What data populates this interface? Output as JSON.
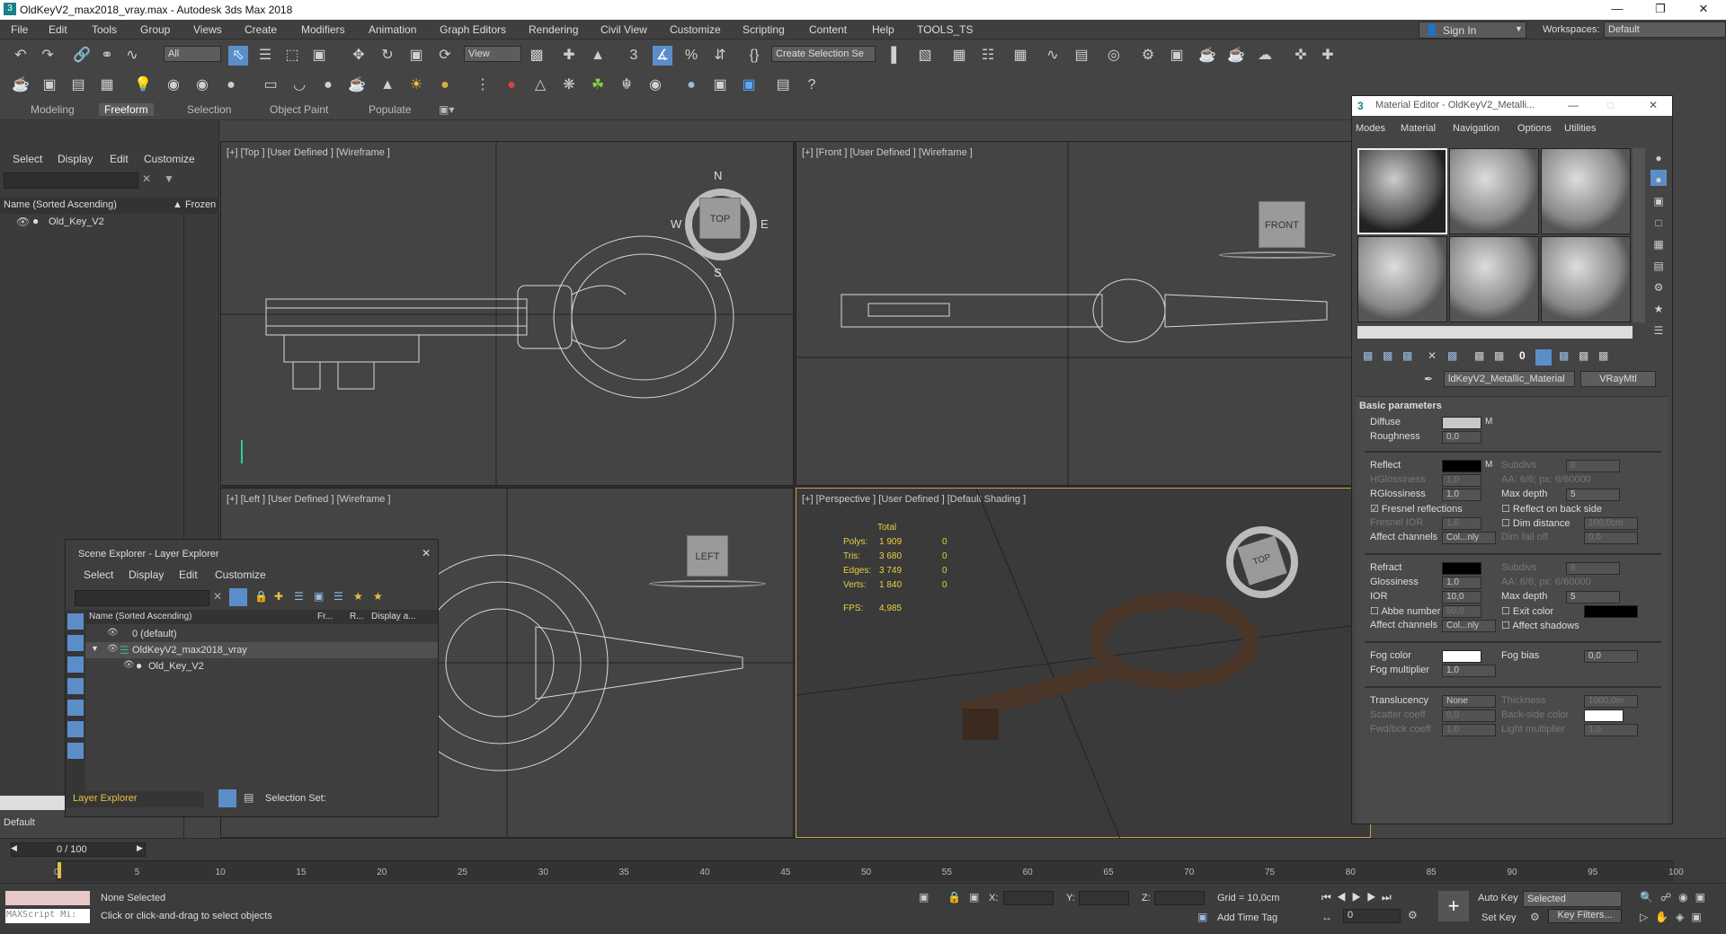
{
  "window": {
    "title": "OldKeyV2_max2018_vray.max - Autodesk 3ds Max 2018"
  },
  "menu": [
    "File",
    "Edit",
    "Tools",
    "Group",
    "Views",
    "Create",
    "Modifiers",
    "Animation",
    "Graph Editors",
    "Rendering",
    "Civil View",
    "Customize",
    "Scripting",
    "Content",
    "Help",
    "TOOLS_TS"
  ],
  "signin": "Sign In",
  "workspaces": {
    "label": "Workspaces:",
    "value": "Default"
  },
  "toolbar": {
    "filter": "All",
    "view": "View",
    "selection_set": "Create Selection Se"
  },
  "ribbon_tabs": [
    "Modeling",
    "Freeform",
    "Selection",
    "Object Paint",
    "Populate"
  ],
  "left_panel": {
    "tabs": [
      "Select",
      "Display",
      "Edit",
      "Customize"
    ],
    "header_name": "Name (Sorted Ascending)",
    "header_frozen": "▲ Frozen",
    "items": [
      "Old_Key_V2"
    ],
    "footer": "Default"
  },
  "viewports": {
    "top": "[+] [Top ] [User Defined ] [Wireframe ]",
    "front": "[+] [Front ] [User Defined ] [Wireframe ]",
    "left": "[+] [Left ] [User Defined ] [Wireframe ]",
    "persp": "[+] [Perspective ] [User Defined ] [Default Shading ]",
    "cube_top": "TOP",
    "cube_front": "FRONT",
    "cube_left": "LEFT",
    "compass": {
      "n": "N",
      "s": "S",
      "e": "E",
      "w": "W"
    },
    "stats": {
      "total_label": "Total",
      "rows": [
        {
          "k": "Polys:",
          "v": "1 909",
          "s": "0"
        },
        {
          "k": "Tris:",
          "v": "3 680",
          "s": "0"
        },
        {
          "k": "Edges:",
          "v": "3 749",
          "s": "0"
        },
        {
          "k": "Verts:",
          "v": "1 840",
          "s": "0"
        }
      ],
      "fps_label": "FPS:",
      "fps": "4,985"
    }
  },
  "scene_explorer": {
    "title": "Scene Explorer - Layer Explorer",
    "menu": [
      "Select",
      "Display",
      "Edit",
      "Customize"
    ],
    "cols": [
      "Name (Sorted Ascending)",
      "Fr...",
      "R...",
      "Display a..."
    ],
    "rows": [
      "0 (default)",
      "OldKeyV2_max2018_vray",
      "Old_Key_V2"
    ],
    "footer_explorer": "Layer Explorer",
    "footer_sel": "Selection Set:"
  },
  "material_editor": {
    "title": "Material Editor - OldKeyV2_Metalli...",
    "menu": [
      "Modes",
      "Material",
      "Navigation",
      "Options",
      "Utilities"
    ],
    "material_name": "ldKeyV2_Metallic_Material",
    "material_type": "VRayMtl",
    "section": "Basic parameters",
    "diffuse": "Diffuse",
    "roughness": {
      "label": "Roughness",
      "value": "0,0"
    },
    "reflect": "Reflect",
    "subdivs1": {
      "label": "Subdivs",
      "value": "8"
    },
    "hgloss": {
      "label": "HGlossiness",
      "value": "1,0"
    },
    "aa1": "AA: 6/6; px: 6/60000",
    "rgloss": {
      "label": "RGlossiness",
      "value": "1,0"
    },
    "maxdepth1": {
      "label": "Max depth",
      "value": "5"
    },
    "fresnel": "Fresnel reflections",
    "backside": "Reflect on back side",
    "fresnel_ior": {
      "label": "Fresnel IOR",
      "value": "1,6"
    },
    "dim_distance": {
      "label": "Dim distance",
      "value": "100,0cm"
    },
    "affect1": {
      "label": "Affect channels",
      "value": "Col...nly"
    },
    "dim_falloff": {
      "label": "Dim fall off",
      "value": "0,0"
    },
    "refract": "Refract",
    "subdivs2": {
      "label": "Subdivs",
      "value": "8"
    },
    "glossiness": {
      "label": "Glossiness",
      "value": "1,0"
    },
    "aa2": "AA: 6/6; px: 6/60000",
    "ior": {
      "label": "IOR",
      "value": "10,0"
    },
    "maxdepth2": {
      "label": "Max depth",
      "value": "5"
    },
    "abbe": {
      "label": "Abbe number",
      "value": "50,0"
    },
    "exit_color": "Exit color",
    "affect2": {
      "label": "Affect channels",
      "value": "Col...nly"
    },
    "affect_shadows": "Affect shadows",
    "fog_color": "Fog color",
    "fog_bias": {
      "label": "Fog bias",
      "value": "0,0"
    },
    "fog_mult": {
      "label": "Fog multiplier",
      "value": "1,0"
    },
    "translucency": {
      "label": "Translucency",
      "value": "None"
    },
    "thickness": {
      "label": "Thickness",
      "value": "1000,0m"
    },
    "scatter": {
      "label": "Scatter coeff",
      "value": "0,0"
    },
    "backside_color": "Back-side color",
    "fwd": {
      "label": "Fwd/bck coeff",
      "value": "1,0"
    },
    "light_mult": {
      "label": "Light multiplier",
      "value": "1,0"
    }
  },
  "timeline": {
    "range": "0 / 100",
    "ticks": [
      "0",
      "5",
      "10",
      "15",
      "20",
      "25",
      "30",
      "35",
      "40",
      "45",
      "50",
      "55",
      "60",
      "65",
      "70",
      "75",
      "80",
      "85",
      "90",
      "95",
      "100"
    ]
  },
  "status": {
    "maxscript": "MAXScript Mi:",
    "none_selected": "None Selected",
    "hint": "Click or click-and-drag to select objects",
    "x": "X:",
    "y": "Y:",
    "z": "Z:",
    "grid": "Grid = 10,0cm",
    "add_time_tag": "Add Time Tag",
    "auto_key": "Auto Key",
    "selected": "Selected",
    "set_key": "Set Key",
    "key_filters": "Key Filters...",
    "frame": "0"
  },
  "colors": {
    "diffuse": "#c8c8c8",
    "reflect": "#000000",
    "refract": "#000000",
    "exit": "#000000",
    "fog": "#ffffff",
    "back": "#ffffff",
    "active_border": "#c8a040"
  }
}
